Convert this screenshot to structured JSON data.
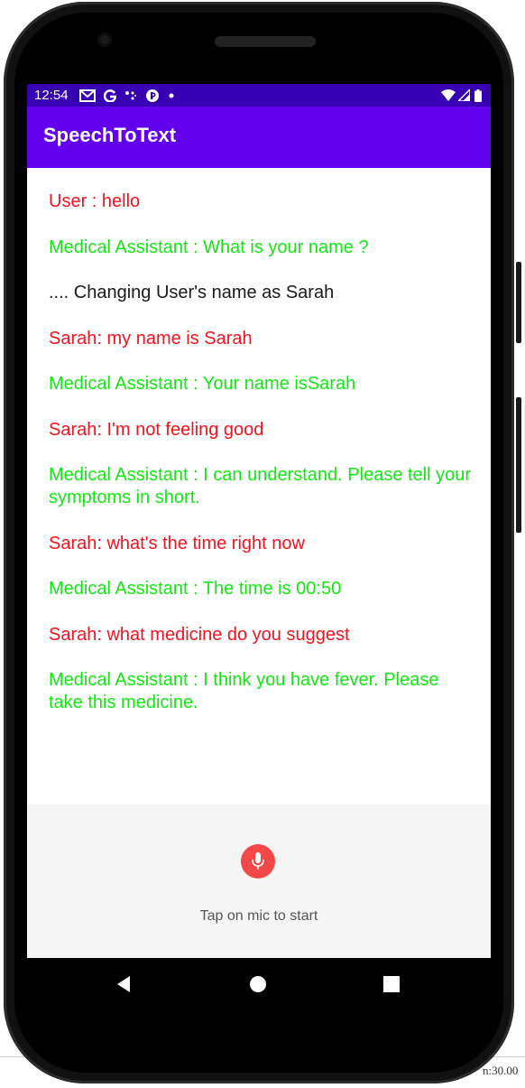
{
  "status_bar": {
    "time": "12:54",
    "icons": [
      "gmail-icon",
      "google-icon",
      "dots-icon",
      "pocket-icon",
      "notification-dot-icon"
    ],
    "right_icons": [
      "wifi-icon",
      "signal-icon",
      "battery-icon"
    ]
  },
  "app_bar": {
    "title": "SpeechToText",
    "color": "#6200ee",
    "status_color": "#3700b3"
  },
  "messages": [
    {
      "type": "user",
      "text": "User : hello"
    },
    {
      "type": "bot",
      "text": "Medical Assistant : What is your name ?"
    },
    {
      "type": "system",
      "text": ".... Changing User's name as Sarah"
    },
    {
      "type": "user",
      "text": "Sarah: my name is Sarah"
    },
    {
      "type": "bot",
      "text": "Medical Assistant : Your name isSarah"
    },
    {
      "type": "user",
      "text": "Sarah: I'm not feeling good"
    },
    {
      "type": "bot",
      "text": "Medical Assistant : I can understand. Please tell your symptoms in short."
    },
    {
      "type": "user",
      "text": "Sarah: what's the time right now"
    },
    {
      "type": "bot",
      "text": "Medical Assistant : The time is 00:50"
    },
    {
      "type": "user",
      "text": "Sarah: what medicine do you suggest"
    },
    {
      "type": "bot",
      "text": "Medical Assistant : I think you have fever. Please take this medicine."
    }
  ],
  "colors": {
    "user": "#f0141e",
    "bot": "#14e614",
    "system": "#1a1a1a",
    "mic": "#f44848"
  },
  "mic": {
    "icon": "microphone-icon",
    "hint": "Tap on mic to start"
  },
  "nav": {
    "back": "back-icon",
    "home": "home-icon",
    "recents": "recents-icon"
  },
  "background_fragments": {
    "bottom_right": "n:30.00"
  }
}
